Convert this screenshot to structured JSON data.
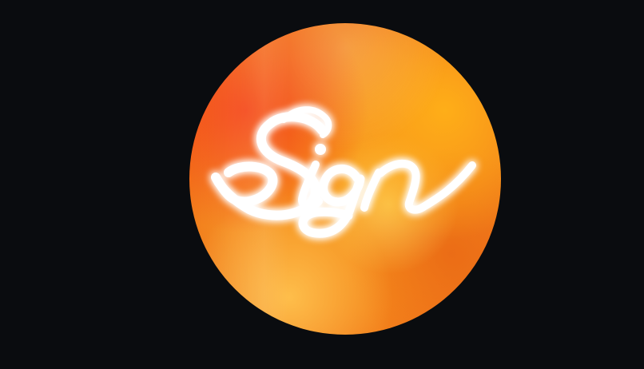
{
  "logo": {
    "wordmark": "Sign",
    "colors": {
      "background": "#0a0c0f",
      "orb_primary": "#f4851b",
      "orb_secondary": "#ffb018",
      "orb_accent": "#f43e1a",
      "text": "#ffffff",
      "glow": "#fff4d6"
    }
  }
}
